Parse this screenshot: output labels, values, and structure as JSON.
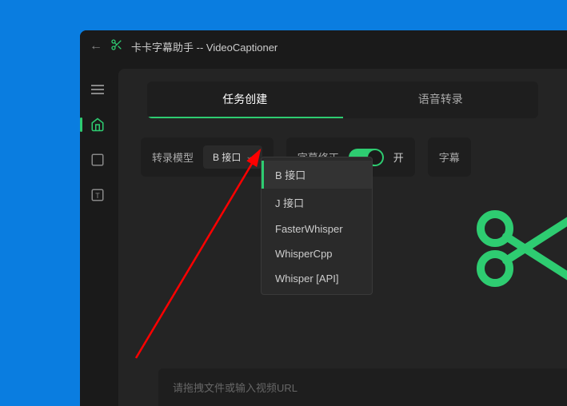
{
  "titlebar": {
    "app_name": "卡卡字幕助手 -- VideoCaptioner"
  },
  "tabs": {
    "create": "任务创建",
    "transcribe": "语音转录"
  },
  "controls": {
    "model_label": "转录模型",
    "model_value": "B 接口",
    "correction_label": "字幕修正",
    "correction_state": "开",
    "extra_label": "字幕"
  },
  "dropdown": {
    "items": [
      "B 接口",
      "J 接口",
      "FasterWhisper",
      "WhisperCpp",
      "Whisper [API]"
    ]
  },
  "input": {
    "placeholder": "请拖拽文件或输入视频URL"
  }
}
